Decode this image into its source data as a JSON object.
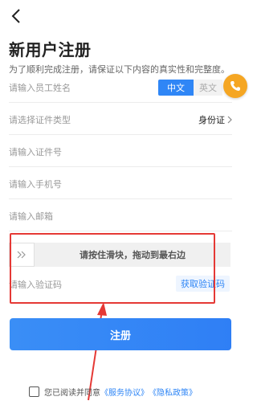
{
  "page": {
    "title": "新用户注册",
    "subtitle": "为了顺利完成注册，请保证以下内容的真实性和完整度。"
  },
  "form": {
    "name_placeholder": "请输入员工姓名",
    "lang_cn": "中文",
    "lang_en": "英文",
    "id_type_placeholder": "请选择证件类型",
    "id_type_value": "身份证",
    "id_number_placeholder": "请输入证件号",
    "phone_placeholder": "请输入手机号",
    "email_placeholder": "请输入邮箱",
    "slider_text": "请按住滑块，拖动到最右边",
    "code_placeholder": "请输入验证码",
    "get_code_label": "获取验证码"
  },
  "register_label": "注册",
  "agreement": {
    "prefix": "您已阅读并同意",
    "service_link": "《服务协议》",
    "privacy_link": "《隐私政策》"
  },
  "colors": {
    "primary": "#2f86f6",
    "annotation": "#e53935",
    "float_button": "#f5a623"
  },
  "icons": {
    "back": "chevron-left-icon",
    "float": "phone-icon",
    "slider": "double-chevron-right-icon",
    "id_type": "chevron-right-icon"
  }
}
